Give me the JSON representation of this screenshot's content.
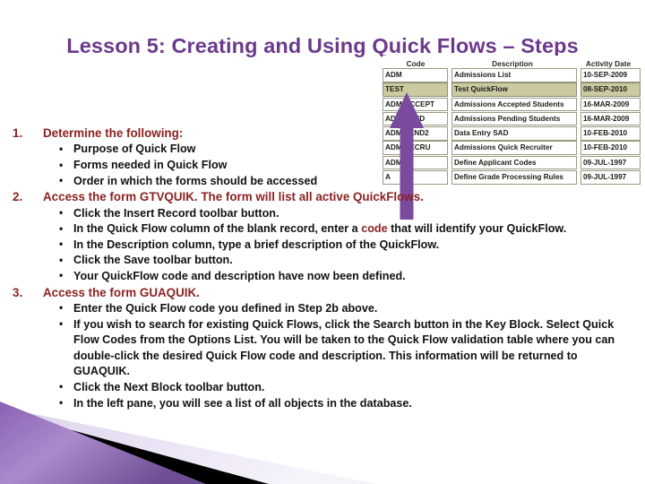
{
  "slide": {
    "title": "Lesson 5: Creating and Using Quick Flows – Steps",
    "title_color": "#6B3A8C",
    "step_color": "#8C2222",
    "sub_color": "#111111",
    "accent_purple": "#7A4A9E",
    "decor_purple": "#9B76C0"
  },
  "steps": [
    {
      "number": "1.",
      "text": "Determine the following:",
      "subs": [
        {
          "text": "Purpose of Quick Flow"
        },
        {
          "text": "Forms needed in Quick Flow"
        },
        {
          "text": "Order in which the forms should be accessed"
        }
      ]
    },
    {
      "number": "2.",
      "text": "Access the form GTVQUIK. The form will list all active QuickFlows.",
      "subs": [
        {
          "text": "Click the Insert Record toolbar button."
        },
        {
          "pre": "In the Quick Flow column of the blank record, enter a ",
          "highlight": "code",
          "post": " that will identify your QuickFlow."
        },
        {
          "text": "In the Description column, type a brief description of the QuickFlow."
        },
        {
          "text": "Click the Save toolbar button."
        },
        {
          "text": "Your QuickFlow code and description have now been defined."
        }
      ]
    },
    {
      "number": "3.",
      "text": "Access the form GUAQUIK.",
      "subs": [
        {
          "text": "Enter the Quick Flow code you defined in Step 2b above."
        },
        {
          "text": "If you wish to search for existing Quick Flows, click the Search button in the Key Block. Select Quick Flow Codes from the Options List. You will be taken to the Quick Flow validation table where you can double-click the desired Quick Flow code and description. This information will be returned to GUAQUIK."
        },
        {
          "text": "Click the Next Block toolbar button."
        },
        {
          "text": "In the left pane, you will see a list of all objects in the database."
        }
      ]
    }
  ],
  "quickflow_table": {
    "headers": [
      "Code",
      "Description",
      "Activity Date"
    ],
    "selected_row_index": 1,
    "selected_row_color": "#CAC9A0",
    "rows": [
      {
        "code": "ADM",
        "description": "Admissions List",
        "activity_date": "10-SEP-2009"
      },
      {
        "code": "TEST",
        "description": "Test QuickFlow",
        "activity_date": "08-SEP-2010"
      },
      {
        "code": "ADM-ACCEPT",
        "description": "Admissions Accepted Students",
        "activity_date": "16-MAR-2009"
      },
      {
        "code": "ADM-PEND",
        "description": "Admissions Pending Students",
        "activity_date": "16-MAR-2009"
      },
      {
        "code": "ADM-PEND2",
        "description": "Data Entry SAD",
        "activity_date": "10-FEB-2010"
      },
      {
        "code": "ADM-RECRU",
        "description": "Admissions Quick Recruiter",
        "activity_date": "10-FEB-2010"
      },
      {
        "code": "ADMR",
        "description": "Define Applicant Codes",
        "activity_date": "09-JUL-1997"
      },
      {
        "code": "A",
        "description": "Define Grade Processing Rules",
        "activity_date": "09-JUL-1997"
      }
    ]
  },
  "annotation": {
    "arrow_label": "arrow pointing to TEST QuickFlow row",
    "arrow_color": "#7A4A9E"
  }
}
